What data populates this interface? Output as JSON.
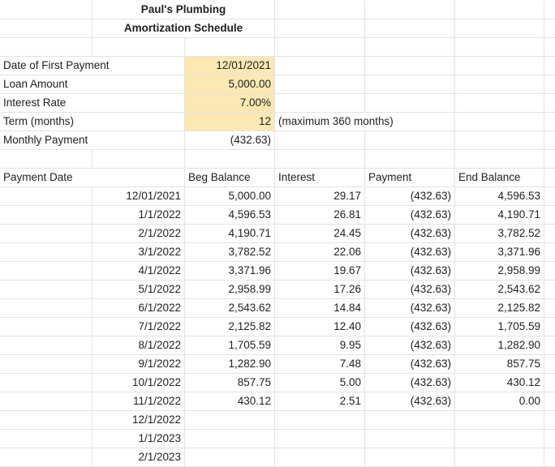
{
  "header": {
    "company": "Paul's Plumbing",
    "subtitle": "Amortization Schedule"
  },
  "inputs": [
    {
      "label": "Date of First Payment",
      "value": "12/01/2021",
      "note": ""
    },
    {
      "label": "Loan Amount",
      "value": "5,000.00",
      "note": ""
    },
    {
      "label": "Interest Rate",
      "value": "7.00%",
      "note": ""
    },
    {
      "label": "Term (months)",
      "value": "12",
      "note": "(maximum 360 months)"
    },
    {
      "label": "Monthly Payment",
      "value": "(432.63)",
      "note": ""
    }
  ],
  "table": {
    "columns": [
      "Payment Date",
      "Beg Balance",
      "Interest",
      "Payment",
      "End Balance"
    ],
    "rows": [
      {
        "date": "12/01/2021",
        "beg": "5,000.00",
        "interest": "29.17",
        "payment": "(432.63)",
        "end": "4,596.53"
      },
      {
        "date": "1/1/2022",
        "beg": "4,596.53",
        "interest": "26.81",
        "payment": "(432.63)",
        "end": "4,190.71"
      },
      {
        "date": "2/1/2022",
        "beg": "4,190.71",
        "interest": "24.45",
        "payment": "(432.63)",
        "end": "3,782.52"
      },
      {
        "date": "3/1/2022",
        "beg": "3,782.52",
        "interest": "22.06",
        "payment": "(432.63)",
        "end": "3,371.96"
      },
      {
        "date": "4/1/2022",
        "beg": "3,371.96",
        "interest": "19.67",
        "payment": "(432.63)",
        "end": "2,958.99"
      },
      {
        "date": "5/1/2022",
        "beg": "2,958.99",
        "interest": "17.26",
        "payment": "(432.63)",
        "end": "2,543.62"
      },
      {
        "date": "6/1/2022",
        "beg": "2,543.62",
        "interest": "14.84",
        "payment": "(432.63)",
        "end": "2,125.82"
      },
      {
        "date": "7/1/2022",
        "beg": "2,125.82",
        "interest": "12.40",
        "payment": "(432.63)",
        "end": "1,705.59"
      },
      {
        "date": "8/1/2022",
        "beg": "1,705.59",
        "interest": "9.95",
        "payment": "(432.63)",
        "end": "1,282.90"
      },
      {
        "date": "9/1/2022",
        "beg": "1,282.90",
        "interest": "7.48",
        "payment": "(432.63)",
        "end": "857.75"
      },
      {
        "date": "10/1/2022",
        "beg": "857.75",
        "interest": "5.00",
        "payment": "(432.63)",
        "end": "430.12"
      },
      {
        "date": "11/1/2022",
        "beg": "430.12",
        "interest": "2.51",
        "payment": "(432.63)",
        "end": "0.00"
      },
      {
        "date": "12/1/2022",
        "beg": "",
        "interest": "",
        "payment": "",
        "end": ""
      },
      {
        "date": "1/1/2023",
        "beg": "",
        "interest": "",
        "payment": "",
        "end": ""
      },
      {
        "date": "2/1/2023",
        "beg": "",
        "interest": "",
        "payment": "",
        "end": ""
      }
    ]
  },
  "colors": {
    "input_highlight": "#fce8b2",
    "gridline": "#e2e3e3",
    "text": "#202124"
  }
}
